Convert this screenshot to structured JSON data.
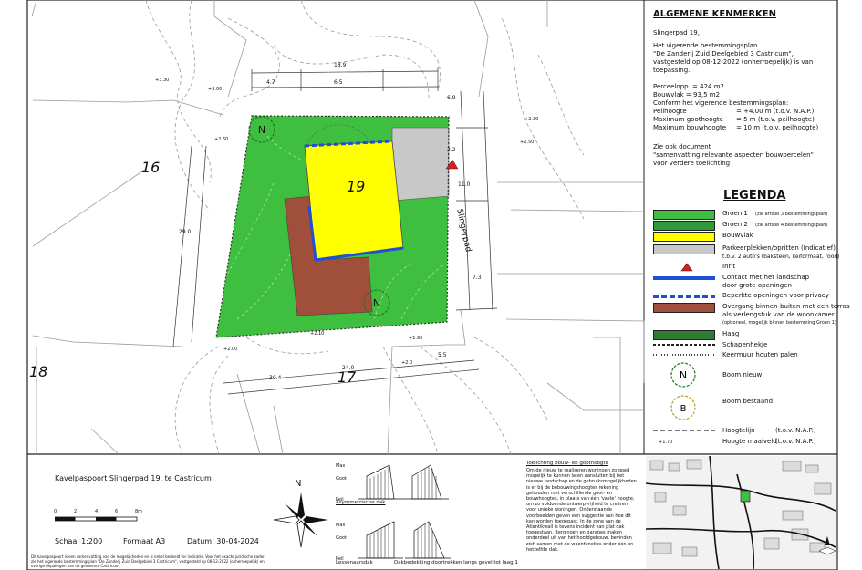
{
  "map": {
    "parcels": {
      "p16": "16",
      "p17": "17",
      "p18": "18",
      "p19": "19"
    },
    "street": "Slingerpad",
    "north": "N",
    "dims": [
      "18.9",
      "4.7",
      "6.5",
      "6.9",
      "2.2",
      "11.0",
      "7.3",
      "29.0",
      "24.0",
      "5.5",
      "30.4"
    ],
    "contours": [
      "+3.30",
      "+3.00",
      "+2.60",
      "+2.00",
      "+2.30",
      "+2.50",
      "+2.10",
      "+1.95",
      "+2.0"
    ]
  },
  "kenmerken": {
    "title": "ALGEMENE KENMERKEN",
    "address": "Slingerpad 19,",
    "intro": [
      "Het vigerende bestemmingsplan",
      "\"De Zanderij Zuid Deelgebied 3 Castricum\",",
      "vastgesteld op 08-12-2022 (onherroepelijk) is van",
      "toepassing."
    ],
    "perceel": "Perceelopp. = 424 m2",
    "bouwvlak": "Bouwvlak = 93,5 m2",
    "conform": "Conform het vigerende bestemmingsplan:",
    "rows": [
      {
        "k": "Peilhoogte",
        "v": "= +4.00 m (t.o.v. N.A.P.)"
      },
      {
        "k": "Maximum goothoogte",
        "v": "= 5 m (t.o.v. peilhoogte)"
      },
      {
        "k": "Maximum bouwhoogte",
        "v": "= 10 m (t.o.v. peilhoogte)"
      }
    ],
    "zie": [
      "Zie ook document",
      "\"samenvatting relevante aspecten bouwpercelen\"",
      "voor verdere toelichting"
    ]
  },
  "legenda": {
    "title": "LEGENDA",
    "items": [
      {
        "label": "Groen 1",
        "note": "(zie artikel 3 bestemmingsplan)"
      },
      {
        "label": "Groen 2",
        "note": "(zie artikel 4 bestemmingsplan)"
      },
      {
        "label": "Bouwvlak",
        "note": ""
      },
      {
        "label": "Parkeerplekken/opritten (Indicatief)",
        "note": "t.b.v. 2 auto's (baksteen, keiformaat, rood)"
      },
      {
        "label": "Inrit",
        "note": ""
      },
      {
        "label": "Contact met het landschap",
        "note": "door grote openingen"
      },
      {
        "label": "Beperkte openingen voor privacy",
        "note": ""
      },
      {
        "label": "Overgang binnen-buiten met een terras",
        "note": "als verlengstuk van de woonkamer"
      },
      {
        "label": "(optioneel, mogelijk binnen bestemming Groen 1)",
        "note": ""
      },
      {
        "label": "Haag",
        "note": ""
      },
      {
        "label": "Schapenhekje",
        "note": ""
      },
      {
        "label": "Keermuur houten palen",
        "note": ""
      },
      {
        "label": "Boom nieuw",
        "note": ""
      },
      {
        "label": "Boom bestaand",
        "note": ""
      }
    ],
    "hoogtelijn": "Hoogtelijn",
    "hoogtelijn_ref": "(t.o.v. N.A.P.)",
    "maaiveld": "Hoogte maaiveld",
    "maaiveld_ref": "(t.o.v. N.A.P.)",
    "maaiveld_sample": "+1.70"
  },
  "titleblock": {
    "name": "Kavelpaspoort Slingerpad 19, te Castricum",
    "scale": "Schaal 1:200",
    "format": "Formaat A3",
    "date": "Datum: 30-04-2024",
    "scale_ticks": [
      "0",
      "2",
      "4",
      "6",
      "8m"
    ],
    "disclaimer": "Dit kavelpaspoort is een samenvatting van de mogelijkheden en is enkel bedoeld ter indicatie. Voor het exacte juridische kader zie het vigerende bestemmingsplan \"De Zanderij Zuid Deelgebied 3 Castricum\", vastgesteld op 08-12-2022 (onherroepelijk) en overige bepalingen van de gemeente Castricum."
  },
  "sections": {
    "asym": "Asymmetrische dak",
    "lessenaar": "Lessenaarsdak",
    "dakbedekking": "Dakbedekking doortrekken langs gevel tot laag 1",
    "labels": [
      "Max",
      "Goot",
      "Peil"
    ]
  },
  "toelichting": {
    "title": "Toelichting bouw- en goothoogte",
    "text": "Om de nieuw te realiseren woningen zo goed mogelijk te kunnen laten aansluiten bij het nieuwe landschap en de gebruiksmogelijkheden is er bij de bebouwingshoogtes rekening gehouden met verschillende goot- en bouwhoogtes, in plaats van één 'vaste' hoogte, om zo voldoende ontwerpvrijheid te creëren voor unieke woningen. Onderstaande voorbeelden geven een suggestie van hoe dit kan worden toegepast. In de zone van de Atlantikwall is tevens incident van plat dak toegestaan. Bergingen en garages maken onderdeel uit van het hoofdgebouw, bevinden zich samen met de woonfuncties onder één en hetzelfde dak."
  },
  "colors": {
    "groen1": "#3fbf3f",
    "groen2": "#2e9a3b",
    "bouwvlak": "#ffff00",
    "parkeer": "#c8c8c8",
    "terras": "#a0503a",
    "contact": "#1f4fd8",
    "haag": "#2e7d32",
    "inrit": "#d62020"
  }
}
